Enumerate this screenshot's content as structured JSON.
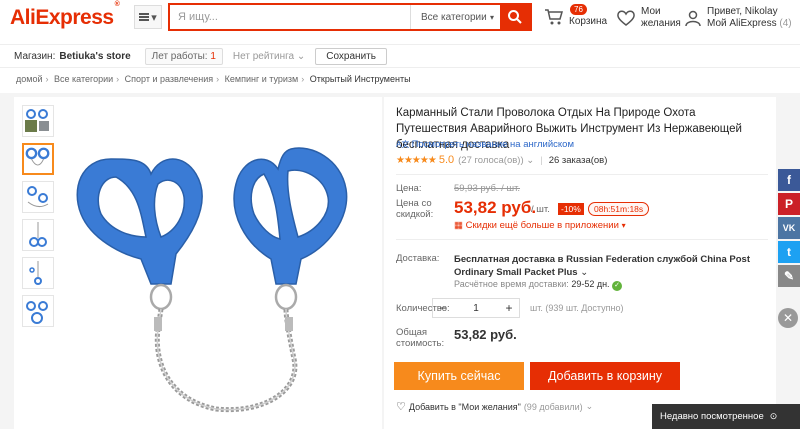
{
  "header": {
    "logo": "AliExpress",
    "menu_label": "▾",
    "search_placeholder": "Я ищу...",
    "search_category": "Все категории",
    "cart_count": "76",
    "cart_label": "Корзина",
    "wishlist_line1": "Мои",
    "wishlist_line2": "желания",
    "account_line1": "Привет, Nikolay",
    "account_line2": "Мой AliExpress",
    "account_count": "(4)"
  },
  "store": {
    "label": "Магазин:",
    "name": "Betiuka's store",
    "years_label": "Лет работы:",
    "years_value": "1",
    "rating": "Нет рейтинга",
    "save": "Сохранить"
  },
  "breadcrumb": [
    "домой",
    "Все категории",
    "Спорт и развлечения",
    "Кемпинг и туризм",
    "Открытый Инструменты"
  ],
  "product": {
    "title": "Карманный Стали Проволока Отдых На Природе Охота Путешествия Аварийного Выжить Инструмент Из Нержавеющей бесплатная доставка",
    "translate_link": "Посмотреть название на английском",
    "score": "5.0",
    "votes": "(27 голоса(ов))",
    "orders": "26 заказа(ов)",
    "price_label": "Цена:",
    "old_price": "59,93 руб. / шт.",
    "discount_price_label_1": "Цена со",
    "discount_price_label_2": "скидкой:",
    "price": "53,82 руб.",
    "unit": "/ шт.",
    "discount": "-10%",
    "timer": "08h:51m:18s",
    "app_discount": "Скидки ещё больше в приложении",
    "shipping_label": "Доставка:",
    "shipping_text": "Бесплатная доставка в Russian Federation службой China Post Ordinary Small Packet Plus",
    "ship_time_label": "Расчётное время доставки:",
    "ship_time_value": "29-52 дн.",
    "qty_label": "Количество:",
    "qty_value": "1",
    "available": "шт. (939 шт. Доступно)",
    "total_label_1": "Общая",
    "total_label_2": "стоимость:",
    "total": "53,82 руб.",
    "buy_now": "Купить сейчас",
    "add_to_cart": "Добавить в корзину",
    "wishlist": "Добавить в \"Мои желания\"",
    "wishlist_count": "(99 добавили)"
  },
  "social": [
    {
      "icon": "facebook-icon",
      "glyph": "f",
      "color": "#3b5998"
    },
    {
      "icon": "pinterest-icon",
      "glyph": "P",
      "color": "#cb2027"
    },
    {
      "icon": "vk-icon",
      "glyph": "VK",
      "color": "#4c75a3"
    },
    {
      "icon": "twitter-icon",
      "glyph": "t",
      "color": "#1da1f2"
    },
    {
      "icon": "edit-icon",
      "glyph": "✎",
      "color": "#888888"
    }
  ],
  "recently_viewed": "Недавно посмотренное",
  "colors": {
    "brand": "#e62e04",
    "accent": "#f78a1c",
    "product_blue": "#3a7bd5"
  }
}
